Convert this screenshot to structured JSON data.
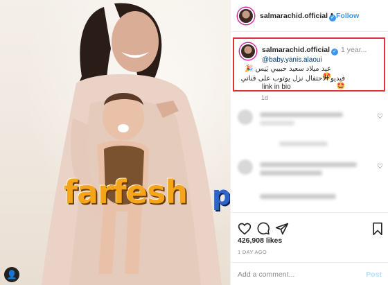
{
  "post": {
    "username": "salmarachid.official",
    "verified_glyph": "✓",
    "follow_label": "Follow",
    "separator": "•"
  },
  "caption": {
    "username": "salmarachid.official",
    "time": "1 year...",
    "mention": "@baby.yanis.alaoui",
    "line1": "عيد ميلاد سعيد حبيبي يَنِس 🎉 🤩",
    "line2": "فيديو الاحتفال نزل يوتوب على قناتي 🤩",
    "line3": "link in bio"
  },
  "caption_time": "1d",
  "actions": {
    "icons": [
      "heart-icon",
      "comment-icon",
      "share-icon",
      "bookmark-icon"
    ],
    "likes": "426,908 likes",
    "posted": "1 DAY AGO",
    "add_comment_placeholder": "Add a comment...",
    "post_label": "Post"
  },
  "watermark": {
    "part1": "farfesh",
    "part2": "plus.com",
    "colors": {
      "part1": "#f4a51c",
      "part2": "#2e63c8"
    }
  },
  "colors": {
    "accent": "#3897f0",
    "highlight_border": "#e03434"
  }
}
